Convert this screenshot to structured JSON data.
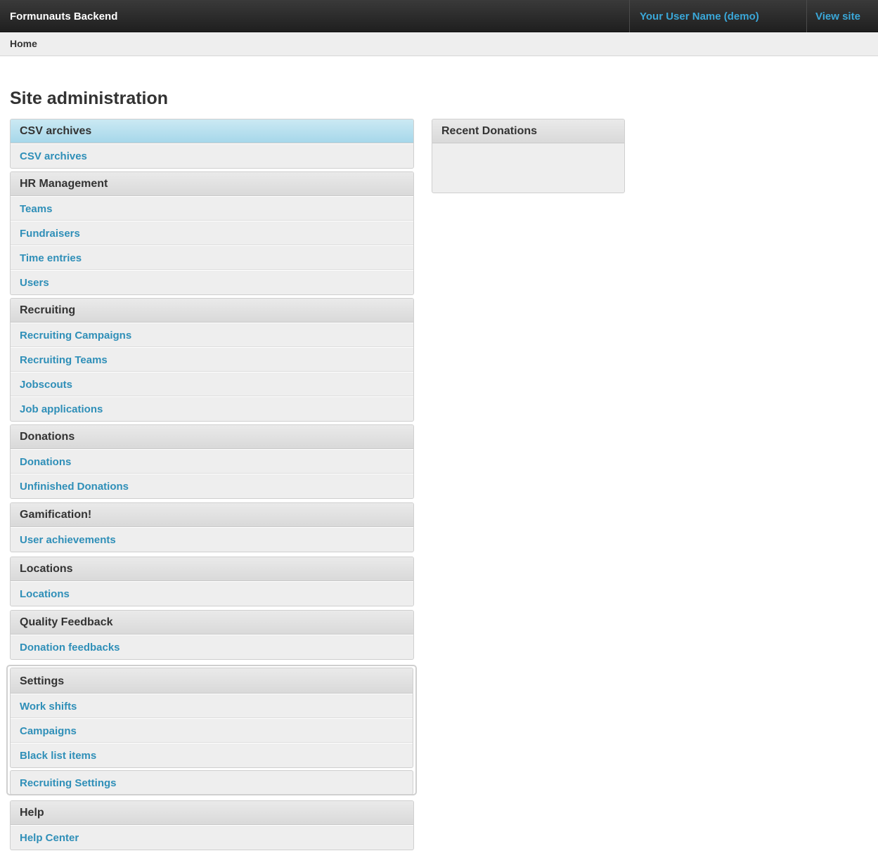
{
  "header": {
    "brand": "Formunauts Backend",
    "user": "Your User Name (demo)",
    "view_site": "View site"
  },
  "breadcrumb": {
    "home": "Home"
  },
  "page": {
    "title": "Site administration"
  },
  "modules": {
    "csv": {
      "title": "CSV archives",
      "items": [
        "CSV archives"
      ]
    },
    "hr": {
      "title": "HR Management",
      "items": [
        "Teams",
        "Fundraisers",
        "Time entries",
        "Users"
      ]
    },
    "recruiting": {
      "title": "Recruiting",
      "items": [
        "Recruiting Campaigns",
        "Recruiting Teams",
        "Jobscouts",
        "Job applications"
      ]
    },
    "donations": {
      "title": "Donations",
      "items": [
        "Donations",
        "Unfinished Donations"
      ]
    },
    "gamification": {
      "title": "Gamification!",
      "items": [
        "User achievements"
      ]
    },
    "locations": {
      "title": "Locations",
      "items": [
        "Locations"
      ]
    },
    "quality": {
      "title": "Quality Feedback",
      "items": [
        "Donation feedbacks"
      ]
    },
    "settings": {
      "title": "Settings",
      "items": [
        "Work shifts",
        "Campaigns",
        "Black list items",
        "Recruiting Settings"
      ]
    },
    "help": {
      "title": "Help",
      "items": [
        "Help Center"
      ]
    }
  },
  "recent": {
    "title": "Recent Donations"
  },
  "colors": {
    "link": "#2f8fb8",
    "header_link": "#3aa7d8",
    "active_header": "#a6d7ea"
  }
}
